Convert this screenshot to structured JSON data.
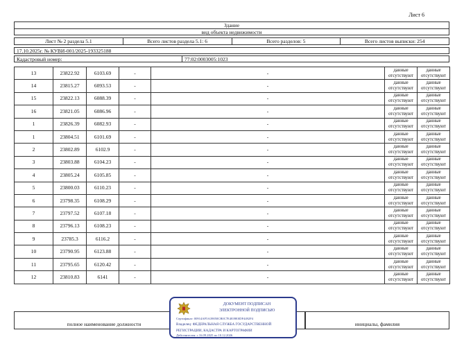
{
  "sheet": {
    "label": "Лист 6"
  },
  "header": {
    "title": "Здание",
    "subtitle": "вид объекта недвижимости"
  },
  "section_row": {
    "sheet_section": "Лист № 2 раздела 5.1",
    "total_section": "Всего листов раздела 5.1: 6",
    "total_sections": "Всего разделов: 5",
    "total_sheets": "Всего листов выписки: 254"
  },
  "doc_line": "17.10.2025г. № КУВИ-001/2025-193325188",
  "cadastral": {
    "label": "Кадастровый номер:",
    "value": "77:02:0003005:1023"
  },
  "rows": [
    {
      "n": "13",
      "x": "23822.92",
      "y": "6103.69",
      "c1": "-",
      "c2": "-",
      "d1": "данные отсутствуют",
      "d2": "данные отсутствуют"
    },
    {
      "n": "14",
      "x": "23815.27",
      "y": "6093.53",
      "c1": "-",
      "c2": "-",
      "d1": "данные отсутствуют",
      "d2": "данные отсутствуют"
    },
    {
      "n": "15",
      "x": "23822.13",
      "y": "6088.39",
      "c1": "-",
      "c2": "-",
      "d1": "данные отсутствуют",
      "d2": "данные отсутствуют"
    },
    {
      "n": "16",
      "x": "23821.05",
      "y": "6086.96",
      "c1": "-",
      "c2": "-",
      "d1": "данные отсутствуют",
      "d2": "данные отсутствуют"
    },
    {
      "n": "1",
      "x": "23826.39",
      "y": "6082.93",
      "c1": "-",
      "c2": "-",
      "d1": "данные отсутствуют",
      "d2": "данные отсутствуют"
    },
    {
      "n": "1",
      "x": "23804.51",
      "y": "6101.69",
      "c1": "-",
      "c2": "-",
      "d1": "данные отсутствуют",
      "d2": "данные отсутствуют"
    },
    {
      "n": "2",
      "x": "23802.89",
      "y": "6102.9",
      "c1": "-",
      "c2": "-",
      "d1": "данные отсутствуют",
      "d2": "данные отсутствуют"
    },
    {
      "n": "3",
      "x": "23803.88",
      "y": "6104.23",
      "c1": "-",
      "c2": "-",
      "d1": "данные отсутствуют",
      "d2": "данные отсутствуют"
    },
    {
      "n": "4",
      "x": "23805.24",
      "y": "6105.85",
      "c1": "-",
      "c2": "-",
      "d1": "данные отсутствуют",
      "d2": "данные отсутствуют"
    },
    {
      "n": "5",
      "x": "23800.03",
      "y": "6110.23",
      "c1": "-",
      "c2": "-",
      "d1": "данные отсутствуют",
      "d2": "данные отсутствуют"
    },
    {
      "n": "6",
      "x": "23798.35",
      "y": "6108.29",
      "c1": "-",
      "c2": "-",
      "d1": "данные отсутствуют",
      "d2": "данные отсутствуют"
    },
    {
      "n": "7",
      "x": "23797.52",
      "y": "6107.18",
      "c1": "-",
      "c2": "-",
      "d1": "данные отсутствуют",
      "d2": "данные отсутствуют"
    },
    {
      "n": "8",
      "x": "23796.13",
      "y": "6108.23",
      "c1": "-",
      "c2": "-",
      "d1": "данные отсутствуют",
      "d2": "данные отсутствуют"
    },
    {
      "n": "9",
      "x": "23785.3",
      "y": "6116.2",
      "c1": "-",
      "c2": "-",
      "d1": "данные отсутствуют",
      "d2": "данные отсутствуют"
    },
    {
      "n": "10",
      "x": "23790.95",
      "y": "6123.88",
      "c1": "-",
      "c2": "-",
      "d1": "данные отсутствуют",
      "d2": "данные отсутствуют"
    },
    {
      "n": "11",
      "x": "23795.65",
      "y": "6120.42",
      "c1": "-",
      "c2": "-",
      "d1": "данные отсутствуют",
      "d2": "данные отсутствуют"
    },
    {
      "n": "12",
      "x": "23810.83",
      "y": "6141",
      "c1": "-",
      "c2": "-",
      "d1": "данные отсутствуют",
      "d2": "данные отсутствуют"
    }
  ],
  "signature": {
    "position_label": "полное наименование должности",
    "name_label": "инициалы, фамилия"
  },
  "stamp": {
    "line1": "ДОКУМЕНТ ПОДПИСАН",
    "line2": "ЭЛЕКТРОННОЙ ПОДПИСЬЮ",
    "certificate": "Сертификат: 00914AF5A39050CB0C7E4839E0DF4492F4",
    "owner": "Владелец: ФЕДЕРАЛЬНАЯ СЛУЖБА ГОСУДАРСТВЕННОЙ",
    "owner2": "РЕГИСТРАЦИИ, КАДАСТРА И КАРТОГРАФИИ",
    "validity": "Действителен: с 16.09.2025 по 10.12.2026",
    "color": "#2b3a8c",
    "icon": "eagle-emblem-icon"
  }
}
